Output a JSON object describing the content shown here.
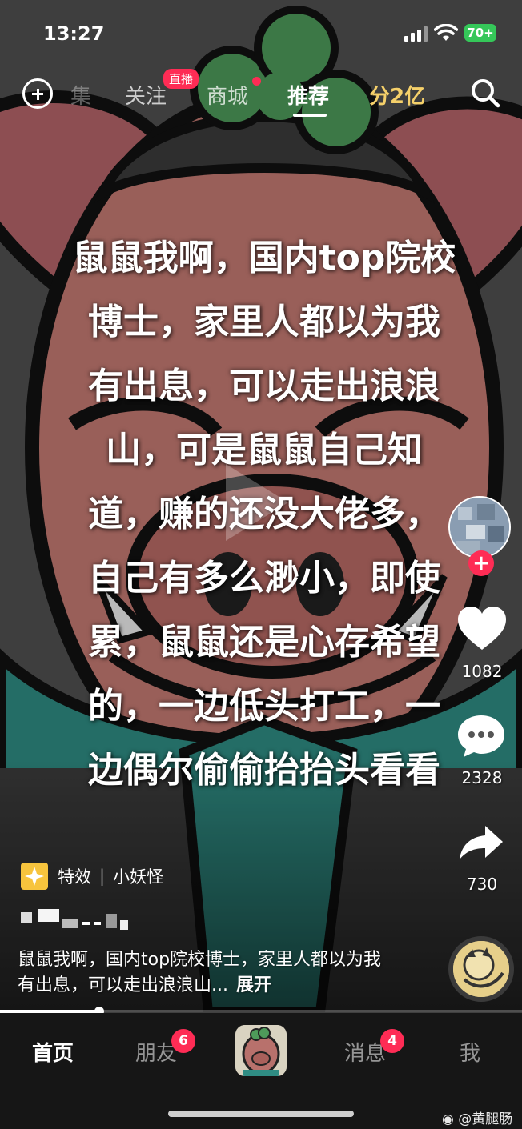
{
  "status_bar": {
    "time": "13:27",
    "battery": "70+"
  },
  "top_nav": {
    "tabs": [
      {
        "label": "集",
        "state": "faded"
      },
      {
        "label": "关注",
        "badge": "直播"
      },
      {
        "label": "商城"
      },
      {
        "label": "推荐",
        "state": "active"
      },
      {
        "label": "分2亿",
        "color": "#f5d06a"
      }
    ],
    "icons": [
      "add-icon",
      "search-icon"
    ]
  },
  "caption_lines": [
    "鼠鼠我啊，国内top院校",
    "博士，家里人都以为我",
    "有出息，可以走出浪浪",
    "山，可是鼠鼠自己知",
    "道，赚的还没大佬多，",
    "自己有多么渺小，即使",
    "累，鼠鼠还是心存希望",
    "的，一边低头打工，一",
    "边偶尔偷偷抬抬头看看"
  ],
  "right_rail": {
    "likes": "1082",
    "comments": "2328",
    "shares": "730"
  },
  "effect": {
    "label": "特效",
    "name": "小妖怪"
  },
  "description": {
    "text": "鼠鼠我啊，国内top院校博士，家里人都以为我有出息，可以走出浪浪山...",
    "expand": "展开"
  },
  "progress": 0.19,
  "tab_bar": {
    "home": "首页",
    "friends": "朋友",
    "friends_badge": "6",
    "messages": "消息",
    "messages_badge": "4",
    "me": "我"
  },
  "watermark": "@黄腿肠",
  "colors": {
    "accent": "#fe2c55",
    "tabbar_bg": "#161616",
    "battery": "#35c759"
  }
}
